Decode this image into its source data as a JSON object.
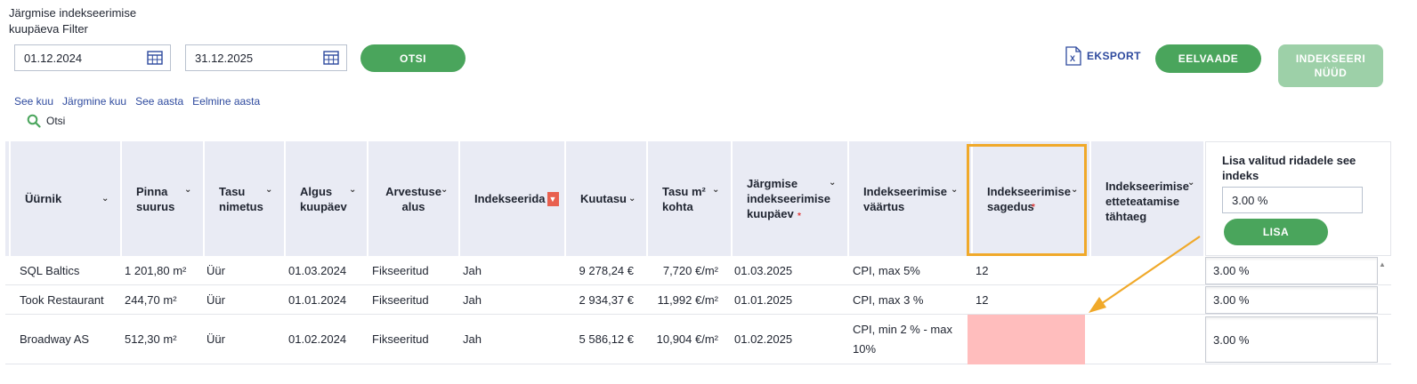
{
  "filter": {
    "label": "Järgmise indekseerimise kuupäeva Filter",
    "date_from": "01.12.2024",
    "date_to": "31.12.2025",
    "search_button": "OTSI"
  },
  "toolbar": {
    "export_label": "EKSPORT",
    "preview_button": "EELVAADE",
    "index_now_button": "INDEKSEERI NÜÜD"
  },
  "quick_links": [
    "See kuu",
    "Järgmine kuu",
    "See aasta",
    "Eelmine aasta"
  ],
  "search_link": "Otsi",
  "columns": [
    {
      "label": "Üürnik"
    },
    {
      "label": "Pinna suurus"
    },
    {
      "label": "Tasu nimetus"
    },
    {
      "label": "Algus kuupäev"
    },
    {
      "label": "Arvestuse alus"
    },
    {
      "label": "Indekseerida"
    },
    {
      "label": "Kuutasu"
    },
    {
      "label": "Tasu m² kohta"
    },
    {
      "label": "Järgmise indekseerimise kuupäev"
    },
    {
      "label": "Indekseerimise väärtus"
    },
    {
      "label": "Indekseerimise sagedus"
    },
    {
      "label": "Indekseerimise etteteatamise tähtaeg"
    }
  ],
  "bulk_index": {
    "label": "Lisa valitud ridadele see indeks",
    "value": "3.00 %",
    "button": "LISA"
  },
  "rows": [
    {
      "tenant": "SQL Baltics",
      "area": "1 201,80 m²",
      "fee_name": "Üür",
      "start": "01.03.2024",
      "basis": "Fikseeritud",
      "index": "Jah",
      "monthly": "9 278,24 €",
      "per_m2": "7,720 €/m²",
      "next_date": "01.03.2025",
      "index_value": "CPI, max 5%",
      "frequency": "12",
      "notice": "",
      "row_index": "3.00 %"
    },
    {
      "tenant": "Took Restaurant",
      "area": "244,70 m²",
      "fee_name": "Üür",
      "start": "01.01.2024",
      "basis": "Fikseeritud",
      "index": "Jah",
      "monthly": "2 934,37 €",
      "per_m2": "11,992 €/m²",
      "next_date": "01.01.2025",
      "index_value": "CPI, max 3 %",
      "frequency": "12",
      "notice": "",
      "row_index": "3.00 %"
    },
    {
      "tenant": "Broadway AS",
      "area": "512,30 m²",
      "fee_name": "Üür",
      "start": "01.02.2024",
      "basis": "Fikseeritud",
      "index": "Jah",
      "monthly": "5 586,12 €",
      "per_m2": "10,904 €/m²",
      "next_date": "01.02.2025",
      "index_value": "CPI, min 2 % - max 10%",
      "frequency": "",
      "notice": "",
      "row_index": "3.00 %"
    }
  ],
  "colors": {
    "accent_green": "#4aa55c",
    "disabled_green": "#9dd0a8",
    "header_bg": "#e9ebf4",
    "highlight": "#f0a92a",
    "missing_value": "#ffbdbd"
  }
}
